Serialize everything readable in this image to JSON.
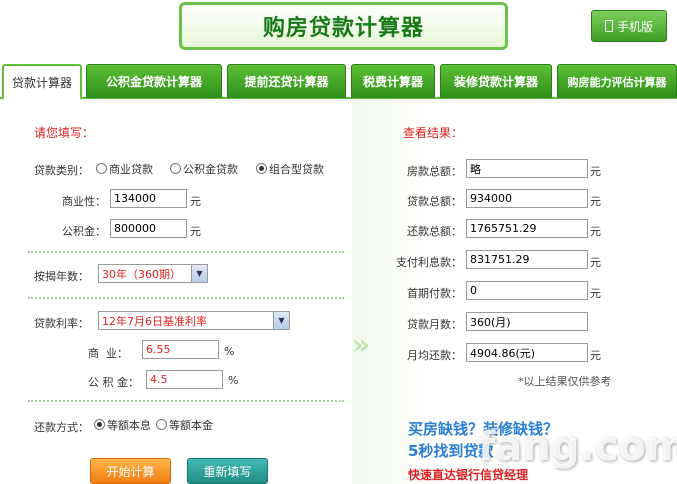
{
  "header": {
    "title": "购房贷款计算器",
    "mobile_label": "手机版"
  },
  "tabs": [
    {
      "label": "贷款计算器",
      "active": true
    },
    {
      "label": "公积金贷款计算器"
    },
    {
      "label": "提前还贷计算器"
    },
    {
      "label": "税费计算器"
    },
    {
      "label": "装修贷款计算器"
    },
    {
      "label": "购房能力评估计算器"
    }
  ],
  "form": {
    "title": "请您填写：",
    "loan_type_label": "贷款类别：",
    "loan_types": [
      "商业贷款",
      "公积金贷款",
      "组合型贷款"
    ],
    "loan_type_selected": "组合型贷款",
    "commercial_label": "商业性：",
    "commercial_value": "134000",
    "fund_label": "公积金：",
    "fund_value": "800000",
    "unit_yuan": "元",
    "years_label": "按揭年数：",
    "years_value": "30年（360期）",
    "rate_label": "贷款利率：",
    "rate_value": "12年7月6日基准利率",
    "commercial_rate_label": "商  业：",
    "commercial_rate_value": "6.55",
    "fund_rate_label": "公 积 金：",
    "fund_rate_value": "4.5",
    "unit_percent": "%",
    "repay_label": "还款方式：",
    "repay_options": [
      "等额本息",
      "等额本金"
    ],
    "repay_selected": "等额本息",
    "calc_button": "开始计算",
    "reset_button": "重新填写"
  },
  "results": {
    "title": "查看结果：",
    "rows": [
      {
        "label": "房款总额：",
        "value": "略",
        "unit": "元"
      },
      {
        "label": "贷款总额：",
        "value": "934000",
        "unit": "元"
      },
      {
        "label": "还款总额：",
        "value": "1765751.29",
        "unit": "元"
      },
      {
        "label": "支付利息款：",
        "value": "831751.29",
        "unit": "元"
      },
      {
        "label": "首期付款：",
        "value": "0",
        "unit": "元"
      },
      {
        "label": "贷款月数：",
        "value": "360(月)",
        "unit": ""
      },
      {
        "label": "月均还款：",
        "value": "4904.86(元)",
        "unit": "元"
      }
    ],
    "note": "*以上结果仅供参考"
  },
  "promo": {
    "line1": "买房缺钱？装修缺钱？",
    "line2": "5秒找到贷款",
    "line3": "快速直达银行信贷经理"
  },
  "watermark": "fang.com"
}
